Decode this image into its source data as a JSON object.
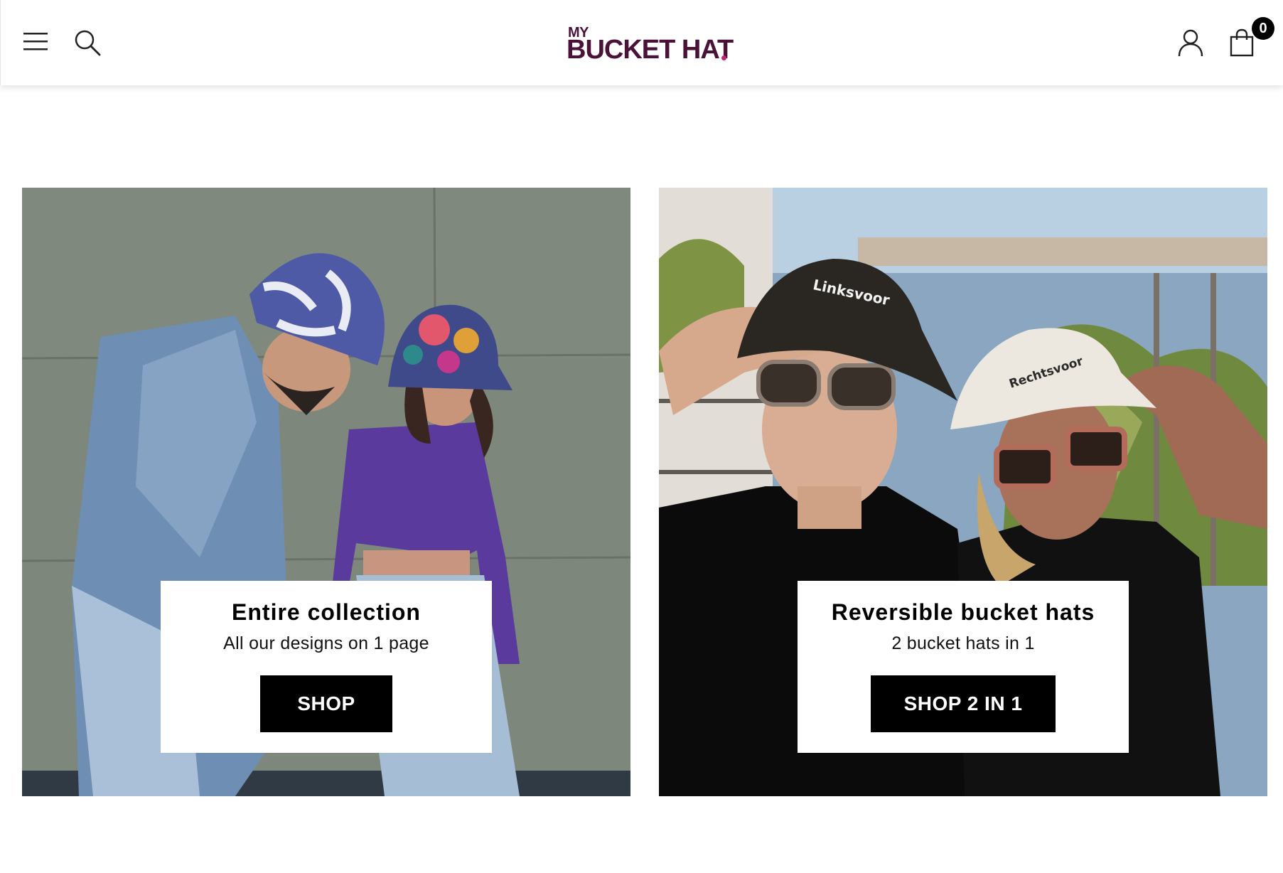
{
  "header": {
    "logo_small": "MY",
    "logo_big": "BUCKET HAT",
    "cart_count": "0",
    "icons": [
      "menu-icon",
      "search-icon",
      "account-icon",
      "cart-icon"
    ]
  },
  "cards": [
    {
      "title": "Entire collection",
      "subtitle": "All our designs on 1 page",
      "button": "SHOP"
    },
    {
      "title": "Reversible bucket hats",
      "subtitle": "2 bucket hats in 1",
      "button": "SHOP 2 IN 1",
      "hat_text_left": "Linksvoor",
      "hat_text_right": "Rechtsvoor"
    }
  ],
  "colors": {
    "brand": "#4a1238",
    "accent": "#c2247a",
    "button_bg": "#000000",
    "button_text": "#ffffff"
  }
}
